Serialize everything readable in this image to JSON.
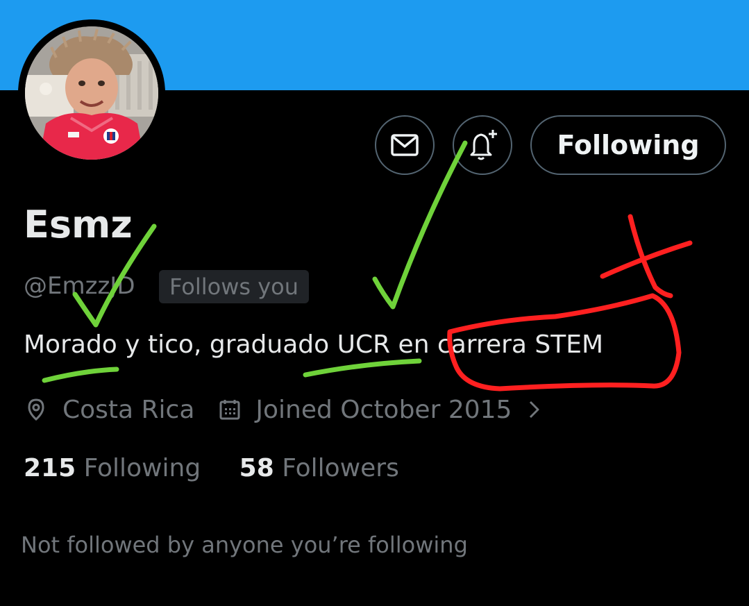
{
  "header": {
    "banner_color": "#1d9bf0"
  },
  "profile": {
    "display_name": "Esmz",
    "handle": "@EmzzJD",
    "follows_you_badge": "Follows you",
    "bio": "Morado y tico, graduado UCR en carrera STEM",
    "location": "Costa Rica",
    "joined": "Joined October 2015"
  },
  "actions": {
    "message_icon": "envelope-icon",
    "notify_icon": "bell-plus-icon",
    "follow_button_label": "Following"
  },
  "stats": {
    "following_count": "215",
    "following_label": "Following",
    "followers_count": "58",
    "followers_label": "Followers"
  },
  "social_context": "Not followed by anyone you’re following",
  "icons": {
    "location": "location-pin-icon",
    "calendar": "calendar-icon",
    "chevron": "chevron-right-icon"
  },
  "annotation_colors": {
    "check": "#6fd23a",
    "cross": "#ff2020"
  }
}
